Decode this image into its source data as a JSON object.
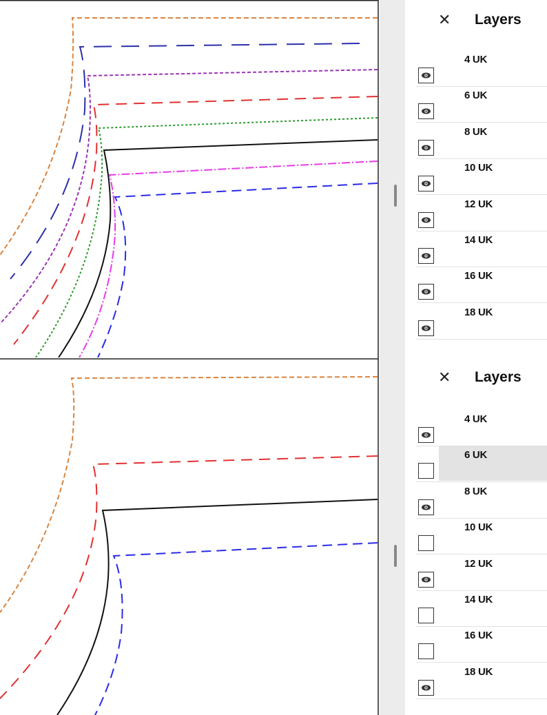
{
  "panel_top": {
    "title": "Layers",
    "close_icon": "close-icon",
    "layers": [
      {
        "label": "4 UK",
        "visible": true
      },
      {
        "label": "6 UK",
        "visible": true
      },
      {
        "label": "8 UK",
        "visible": true
      },
      {
        "label": "10 UK",
        "visible": true
      },
      {
        "label": "12 UK",
        "visible": true
      },
      {
        "label": "14 UK",
        "visible": true
      },
      {
        "label": "16 UK",
        "visible": true
      },
      {
        "label": "18 UK",
        "visible": true
      }
    ]
  },
  "panel_bottom": {
    "title": "Layers",
    "close_icon": "close-icon",
    "selected_layer": "6 UK",
    "layers": [
      {
        "label": "4 UK",
        "visible": true
      },
      {
        "label": "6 UK",
        "visible": false
      },
      {
        "label": "8 UK",
        "visible": true
      },
      {
        "label": "10 UK",
        "visible": false
      },
      {
        "label": "12 UK",
        "visible": true
      },
      {
        "label": "14 UK",
        "visible": false
      },
      {
        "label": "16 UK",
        "visible": false
      },
      {
        "label": "18 UK",
        "visible": true
      }
    ]
  },
  "colors": {
    "4 UK": "#d9843f",
    "6 UK": "#2b2fa8",
    "8 UK": "#9b35b5",
    "10 UK": "#e23030",
    "12 UK": "#2a9a2a",
    "14 UK": "#111111",
    "16 UK": "#e63be6",
    "18 UK": "#2a2ae6"
  },
  "icons": {
    "visibility": "eye-icon"
  }
}
